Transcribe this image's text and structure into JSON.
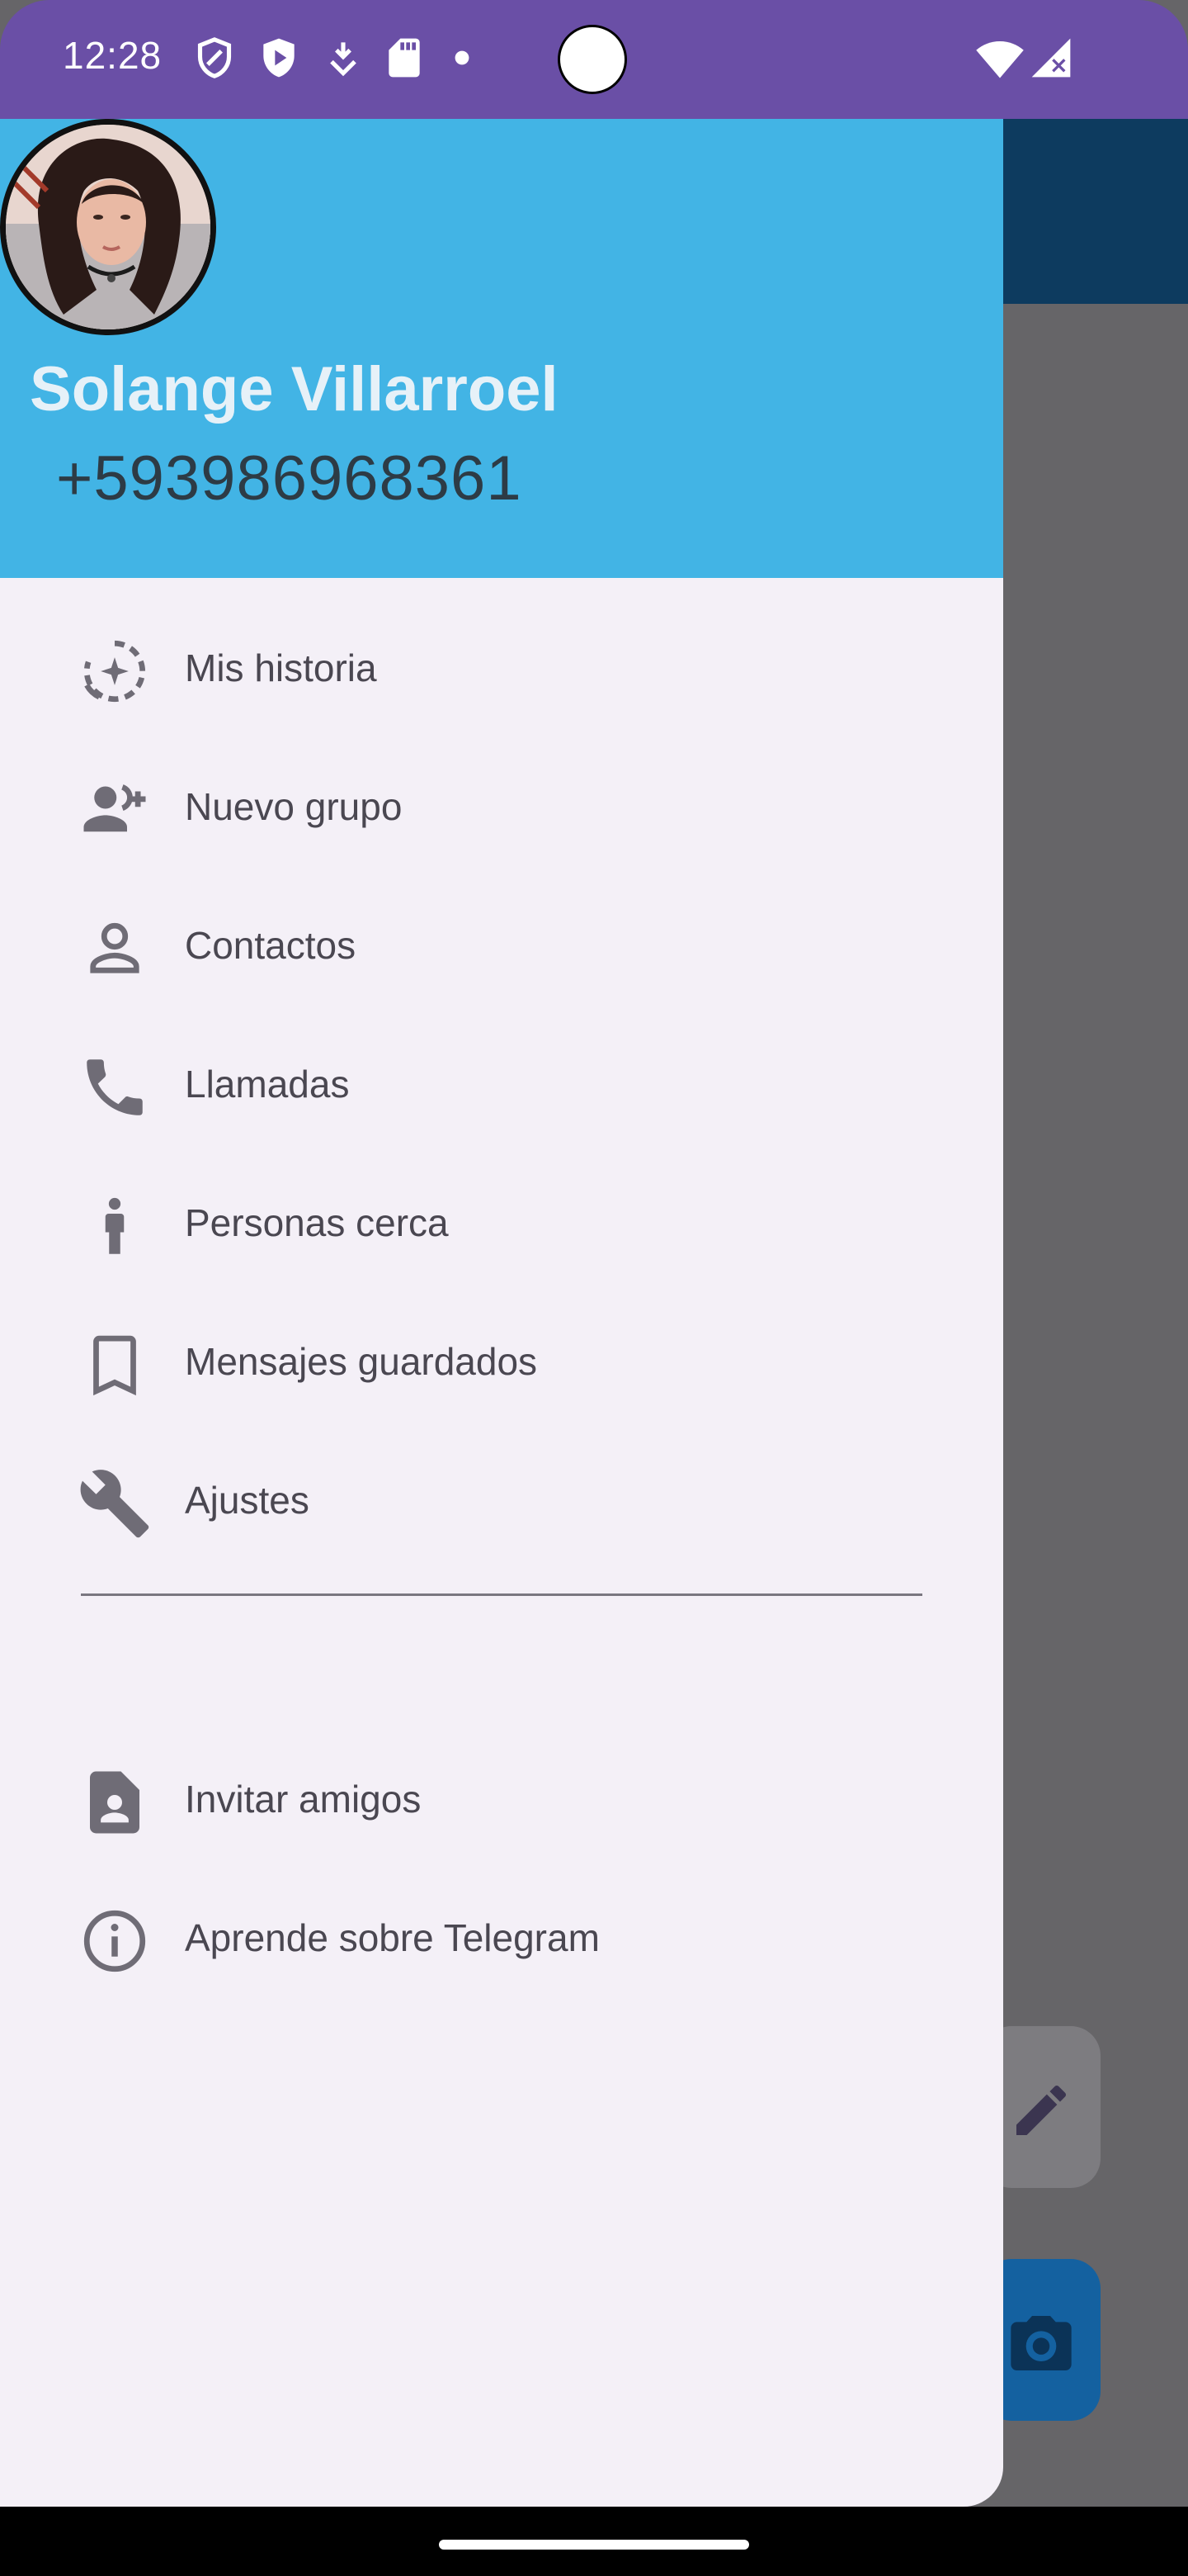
{
  "status_bar": {
    "time": "12:28",
    "icons": [
      "shield-icon",
      "play-shield-icon",
      "download-icon",
      "sd-card-icon",
      "dot-icon",
      "wifi-icon",
      "cell-signal-icon"
    ],
    "color": "#6A4FA6"
  },
  "drawer": {
    "header": {
      "name": "Solange Villarroel",
      "phone": "+593986968361",
      "background": "#42B4E5"
    },
    "menu_items": [
      {
        "label": "Mis historia",
        "icon": "story-icon"
      },
      {
        "label": "Nuevo grupo",
        "icon": "add-group-icon"
      },
      {
        "label": "Contactos",
        "icon": "person-icon"
      },
      {
        "label": "Llamadas",
        "icon": "phone-icon"
      },
      {
        "label": "Personas cerca",
        "icon": "person-nearby-icon"
      },
      {
        "label": "Mensajes guardados",
        "icon": "bookmark-icon"
      },
      {
        "label": "Ajustes",
        "icon": "wrench-icon"
      }
    ],
    "secondary_items": [
      {
        "label": "Invitar amigos",
        "icon": "contact-card-icon"
      },
      {
        "label": "Aprende sobre Telegram",
        "icon": "info-icon"
      }
    ]
  },
  "background_app": {
    "fabs": [
      "pencil-icon",
      "camera-icon"
    ]
  }
}
